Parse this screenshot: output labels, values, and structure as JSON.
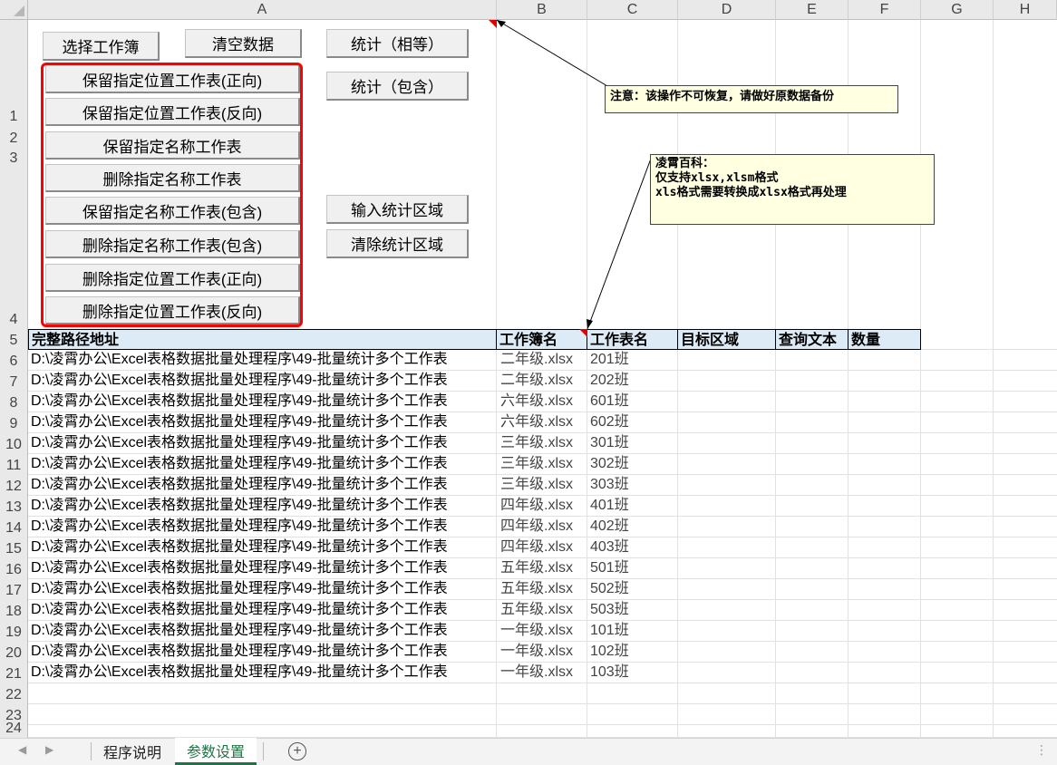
{
  "columns": [
    "A",
    "B",
    "C",
    "D",
    "E",
    "F",
    "G",
    "H"
  ],
  "rows": [
    "1",
    "2",
    "3",
    "4",
    "5",
    "6",
    "7",
    "8",
    "9",
    "10",
    "11",
    "12",
    "13",
    "14",
    "15",
    "16",
    "17",
    "18",
    "19",
    "20",
    "21",
    "22",
    "23",
    "24"
  ],
  "buttons": {
    "select_workbook": "选择工作簿",
    "clear_data": "清空数据",
    "count_equal": "统计（相等）",
    "count_contains": "统计（包含）",
    "input_region": "输入统计区域",
    "clear_region": "清除统计区域",
    "group": [
      "保留指定位置工作表(正向)",
      "保留指定位置工作表(反向)",
      "保留指定名称工作表",
      "删除指定名称工作表",
      "保留指定名称工作表(包含)",
      "删除指定名称工作表(包含)",
      "删除指定位置工作表(正向)",
      "删除指定位置工作表(反向)"
    ]
  },
  "notes": {
    "warning": "注意：该操作不可恢复，请做好原数据备份",
    "info_lines": [
      "凌霄百科：",
      "仅支持xlsx,xlsm格式",
      "xls格式需要转换成xlsx格式再处理"
    ]
  },
  "table": {
    "headers": [
      "完整路径地址",
      "工作簿名",
      "工作表名",
      "目标区域",
      "查询文本",
      "数量"
    ],
    "rows": [
      {
        "path": "D:\\凌霄办公\\Excel表格数据批量处理程序\\49-批量统计多个工作表",
        "book": "二年级.xlsx",
        "sheet": "201班"
      },
      {
        "path": "D:\\凌霄办公\\Excel表格数据批量处理程序\\49-批量统计多个工作表",
        "book": "二年级.xlsx",
        "sheet": "202班"
      },
      {
        "path": "D:\\凌霄办公\\Excel表格数据批量处理程序\\49-批量统计多个工作表",
        "book": "六年级.xlsx",
        "sheet": "601班"
      },
      {
        "path": "D:\\凌霄办公\\Excel表格数据批量处理程序\\49-批量统计多个工作表",
        "book": "六年级.xlsx",
        "sheet": "602班"
      },
      {
        "path": "D:\\凌霄办公\\Excel表格数据批量处理程序\\49-批量统计多个工作表",
        "book": "三年级.xlsx",
        "sheet": "301班"
      },
      {
        "path": "D:\\凌霄办公\\Excel表格数据批量处理程序\\49-批量统计多个工作表",
        "book": "三年级.xlsx",
        "sheet": "302班"
      },
      {
        "path": "D:\\凌霄办公\\Excel表格数据批量处理程序\\49-批量统计多个工作表",
        "book": "三年级.xlsx",
        "sheet": "303班"
      },
      {
        "path": "D:\\凌霄办公\\Excel表格数据批量处理程序\\49-批量统计多个工作表",
        "book": "四年级.xlsx",
        "sheet": "401班"
      },
      {
        "path": "D:\\凌霄办公\\Excel表格数据批量处理程序\\49-批量统计多个工作表",
        "book": "四年级.xlsx",
        "sheet": "402班"
      },
      {
        "path": "D:\\凌霄办公\\Excel表格数据批量处理程序\\49-批量统计多个工作表",
        "book": "四年级.xlsx",
        "sheet": "403班"
      },
      {
        "path": "D:\\凌霄办公\\Excel表格数据批量处理程序\\49-批量统计多个工作表",
        "book": "五年级.xlsx",
        "sheet": "501班"
      },
      {
        "path": "D:\\凌霄办公\\Excel表格数据批量处理程序\\49-批量统计多个工作表",
        "book": "五年级.xlsx",
        "sheet": "502班"
      },
      {
        "path": "D:\\凌霄办公\\Excel表格数据批量处理程序\\49-批量统计多个工作表",
        "book": "五年级.xlsx",
        "sheet": "503班"
      },
      {
        "path": "D:\\凌霄办公\\Excel表格数据批量处理程序\\49-批量统计多个工作表",
        "book": "一年级.xlsx",
        "sheet": "101班"
      },
      {
        "path": "D:\\凌霄办公\\Excel表格数据批量处理程序\\49-批量统计多个工作表",
        "book": "一年级.xlsx",
        "sheet": "102班"
      },
      {
        "path": "D:\\凌霄办公\\Excel表格数据批量处理程序\\49-批量统计多个工作表",
        "book": "一年级.xlsx",
        "sheet": "103班"
      }
    ]
  },
  "sheet_tabs": [
    "程序说明",
    "参数设置"
  ],
  "active_tab": "参数设置",
  "colors": {
    "accent_green": "#217346",
    "highlight_border": "#ff0000",
    "header_fill": "#ddebf7",
    "note_fill": "#ffffe1"
  }
}
